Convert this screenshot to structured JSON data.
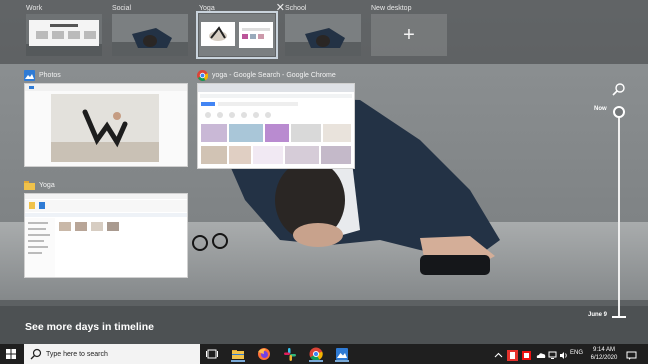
{
  "desktops": [
    {
      "label": "Work",
      "active": false
    },
    {
      "label": "Social",
      "active": false
    },
    {
      "label": "Yoga",
      "active": true
    },
    {
      "label": "School",
      "active": false
    },
    {
      "label": "New desktop",
      "active": false
    }
  ],
  "desktop_close_glyph": "✕",
  "new_desktop_glyph": "+",
  "windows": [
    {
      "title": "Photos",
      "icon": "photos-icon"
    },
    {
      "title": "yoga - Google Search - Google Chrome",
      "icon": "chrome-icon"
    },
    {
      "title": "Yoga",
      "icon": "folder-icon"
    }
  ],
  "timeline": {
    "now_label": "Now",
    "date_label": "June 9",
    "see_more": "See more days in timeline"
  },
  "taskbar": {
    "search_placeholder": "Type here to search",
    "pinned": [
      "task-view-icon",
      "file-explorer-icon",
      "firefox-icon",
      "slack-icon",
      "chrome-icon",
      "photos-icon"
    ],
    "tray": {
      "language": "ENG",
      "time": "9:14 AM",
      "date": "6/12/2020"
    }
  },
  "colors": {
    "taskbar": "#1f1f1f",
    "accent": "#79a9d6",
    "chrome_red": "#db4437",
    "chrome_green": "#0f9d58",
    "chrome_yellow": "#f4b400",
    "folder": "#f0c24b"
  }
}
